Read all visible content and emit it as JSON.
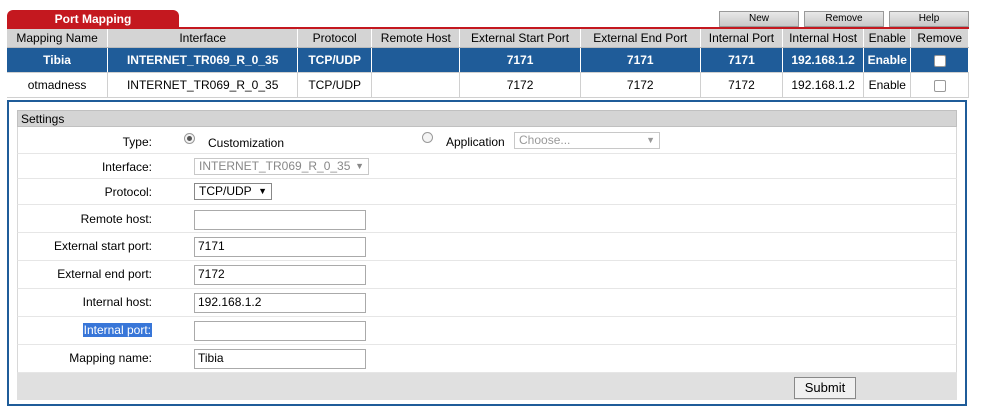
{
  "page_tab": "Port Mapping",
  "toolbar": {
    "new": "New",
    "remove": "Remove",
    "help": "Help"
  },
  "table": {
    "headers": [
      "Mapping Name",
      "Interface",
      "Protocol",
      "Remote Host",
      "External Start Port",
      "External End Port",
      "Internal Port",
      "Internal Host",
      "Enable",
      "Remove"
    ],
    "rows": [
      {
        "name": "Tibia",
        "interface": "INTERNET_TR069_R_0_35",
        "protocol": "TCP/UDP",
        "remote_host": "",
        "ext_start": "7171",
        "ext_end": "7171",
        "int_port": "7171",
        "int_host": "192.168.1.2",
        "enable": "Enable"
      },
      {
        "name": "otmadness",
        "interface": "INTERNET_TR069_R_0_35",
        "protocol": "TCP/UDP",
        "remote_host": "",
        "ext_start": "7172",
        "ext_end": "7172",
        "int_port": "7172",
        "int_host": "192.168.1.2",
        "enable": "Enable"
      }
    ]
  },
  "settings": {
    "title": "Settings",
    "type_label": "Type:",
    "customization": "Customization",
    "application": "Application",
    "app_placeholder": "Choose...",
    "interface_label": "Interface:",
    "interface_value": "INTERNET_TR069_R_0_35",
    "protocol_label": "Protocol:",
    "protocol_value": "TCP/UDP",
    "remote_host_label": "Remote host:",
    "remote_host_value": "",
    "ext_start_label": "External start port:",
    "ext_start_value": "7171",
    "ext_end_label": "External end port:",
    "ext_end_value": "7172",
    "int_host_label": "Internal host:",
    "int_host_value": "192.168.1.2",
    "int_port_label": "Internal port:",
    "int_port_value": "",
    "mapping_name_label": "Mapping name:",
    "mapping_name_value": "Tibia",
    "submit": "Submit"
  },
  "colors": {
    "accent_red": "#c4181f",
    "selected_blue": "#1f5c99"
  }
}
